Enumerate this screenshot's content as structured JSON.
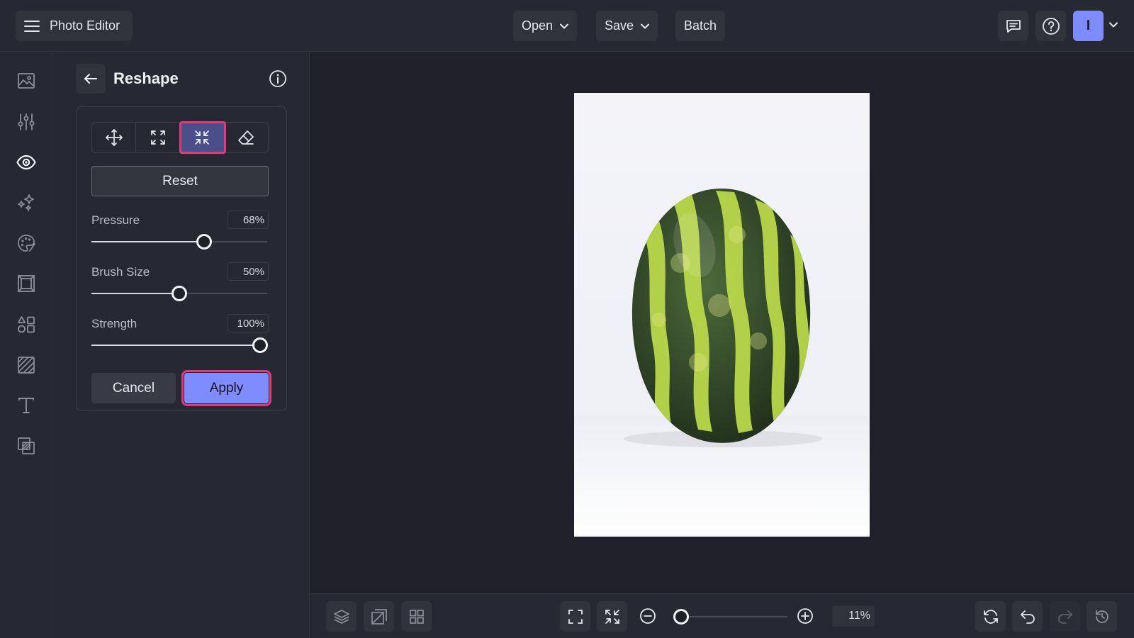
{
  "app": {
    "title": "Photo Editor",
    "avatar_initial": "I"
  },
  "topbar": {
    "open_label": "Open",
    "save_label": "Save",
    "batch_label": "Batch",
    "icons": [
      "menu-icon",
      "chevron-down-icon",
      "comment-icon",
      "help-icon",
      "avatar",
      "chevron-down-icon"
    ]
  },
  "rail": {
    "items": [
      {
        "name": "image-icon",
        "active": false
      },
      {
        "name": "adjust-sliders-icon",
        "active": false
      },
      {
        "name": "eye-icon",
        "active": true
      },
      {
        "name": "sparkles-icon",
        "active": false
      },
      {
        "name": "palette-icon",
        "active": false
      },
      {
        "name": "frame-icon",
        "active": false
      },
      {
        "name": "shapes-icon",
        "active": false
      },
      {
        "name": "texture-icon",
        "active": false
      },
      {
        "name": "text-icon",
        "active": false
      },
      {
        "name": "overlay-icon",
        "active": false
      }
    ]
  },
  "panel": {
    "title": "Reshape",
    "tools": [
      {
        "name": "move-icon",
        "active": false
      },
      {
        "name": "expand-icon",
        "active": false
      },
      {
        "name": "shrink-icon",
        "active": true
      },
      {
        "name": "eraser-icon",
        "active": false
      }
    ],
    "reset_label": "Reset",
    "sliders": [
      {
        "label": "Pressure",
        "value_text": "68%",
        "value": 0.64
      },
      {
        "label": "Brush Size",
        "value_text": "50%",
        "value": 0.5
      },
      {
        "label": "Strength",
        "value_text": "100%",
        "value": 0.96
      }
    ],
    "cancel_label": "Cancel",
    "apply_label": "Apply"
  },
  "canvas": {
    "image_subject": "watermelon"
  },
  "bottombar": {
    "zoom_text": "11%",
    "zoom_level": 0.03,
    "icons": [
      "layers-icon",
      "compare-icon",
      "grid-icon",
      "fit-screen-icon",
      "actual-size-icon",
      "zoom-out-icon",
      "zoom-in-icon",
      "reset-rotate-icon",
      "undo-icon",
      "redo-icon",
      "history-icon"
    ]
  },
  "colors": {
    "accent": "#7f8cff",
    "highlight": "#e23a78",
    "background": "#1f2029",
    "panel": "#262833"
  }
}
